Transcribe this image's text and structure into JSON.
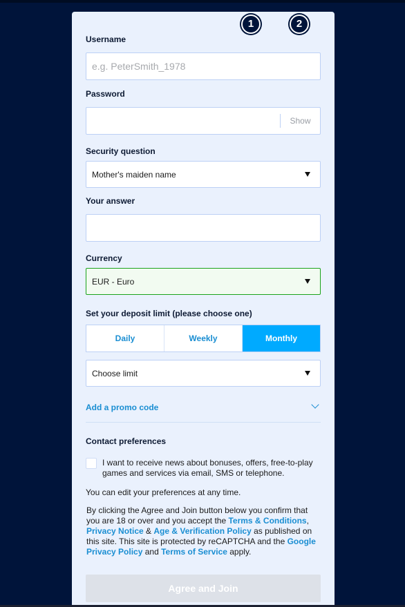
{
  "steps": [
    "1",
    "2"
  ],
  "form": {
    "username": {
      "label": "Username",
      "placeholder": "e.g. PeterSmith_1978",
      "value": ""
    },
    "password": {
      "label": "Password",
      "value": "",
      "show_label": "Show"
    },
    "security_question": {
      "label": "Security question",
      "selected": "Mother's maiden name"
    },
    "answer": {
      "label": "Your answer",
      "value": ""
    },
    "currency": {
      "label": "Currency",
      "selected": "EUR - Euro",
      "state": "valid"
    },
    "deposit_limit": {
      "label": "Set your deposit limit (please choose one)",
      "tabs": [
        {
          "label": "Daily",
          "active": false
        },
        {
          "label": "Weekly",
          "active": false
        },
        {
          "label": "Monthly",
          "active": true
        }
      ],
      "limit_selected": "Choose limit"
    },
    "promo": {
      "label": "Add a promo code"
    },
    "contact": {
      "heading": "Contact preferences",
      "checkbox_label": "I want to receive news about bonuses, offers, free-to-play games and services via email, SMS or telephone.",
      "checked": false,
      "note": "You can edit your preferences at any time."
    },
    "legal": {
      "t1": "By clicking the Agree and Join button below you confirm that you are 18 or over and you accept the ",
      "link_terms": "Terms & Conditions",
      "t2": ", ",
      "link_privacy": "Privacy Notice",
      "t3": " & ",
      "link_age": "Age & Verification Policy",
      "t4": " as published on this site. This site is protected by reCAPTCHA and the ",
      "link_google_privacy": "Google Privacy Policy",
      "t5": " and ",
      "link_tos": "Terms of Service",
      "t6": " apply."
    },
    "submit_label": "Agree and Join"
  },
  "colors": {
    "accent": "#00aaff",
    "link": "#1a8ed2",
    "background": "#00143a",
    "card": "#eaf1fd",
    "valid": "#1aa31a"
  }
}
